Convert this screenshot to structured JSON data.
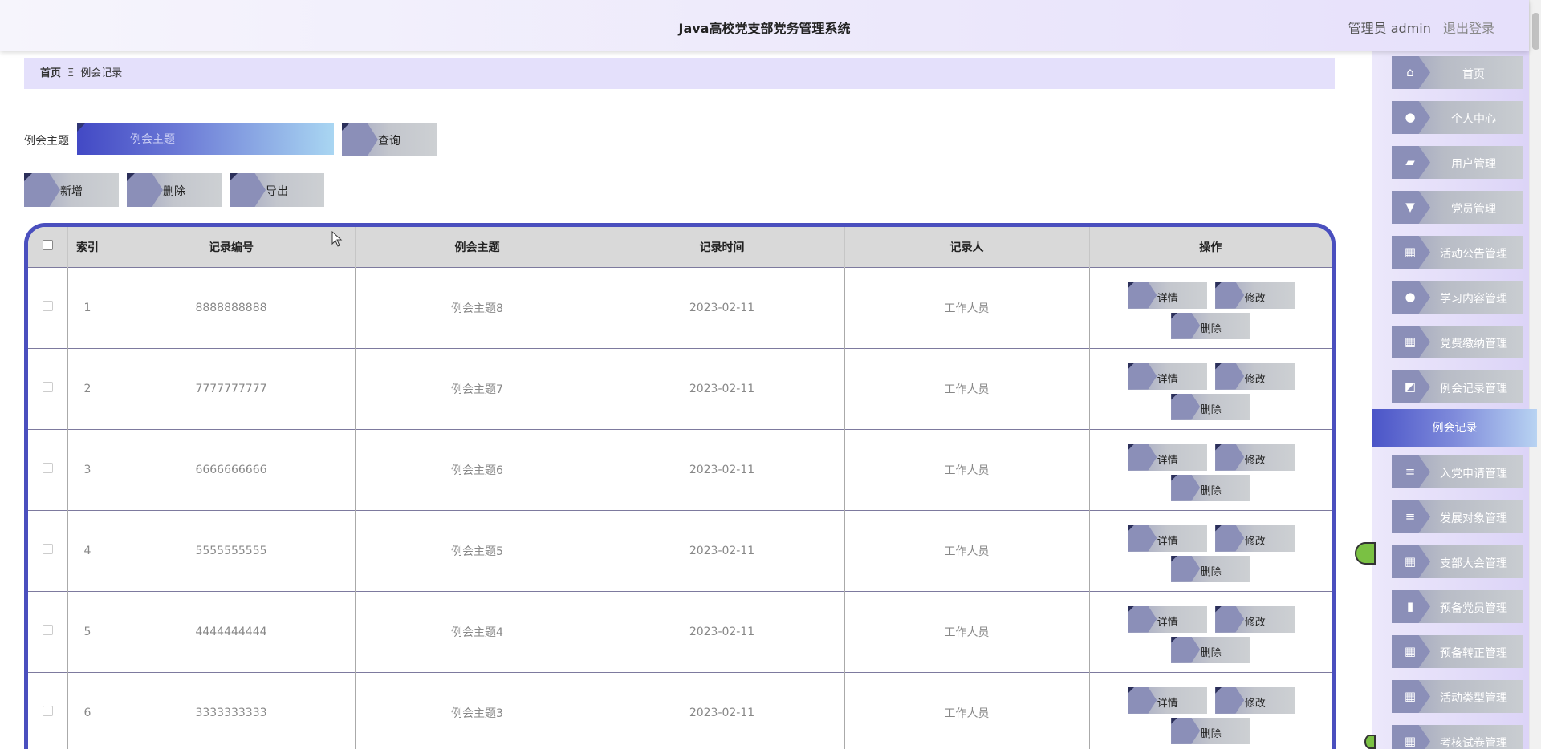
{
  "header": {
    "title": "Java高校党支部党务管理系统",
    "role": "管理员 admin",
    "logout": "退出登录"
  },
  "breadcrumb": {
    "home": "首页",
    "separator": "Ξ",
    "current": "例会记录"
  },
  "search": {
    "label": "例会主题",
    "placeholder": "例会主题",
    "query_button": "查询"
  },
  "actions": {
    "add": "新增",
    "delete": "删除",
    "export": "导出"
  },
  "table": {
    "columns": [
      "索引",
      "记录编号",
      "例会主题",
      "记录时间",
      "记录人",
      "操作"
    ],
    "rows": [
      {
        "index": "1",
        "code": "8888888888",
        "topic": "例会主题8",
        "time": "2023-02-11",
        "recorder": "工作人员"
      },
      {
        "index": "2",
        "code": "7777777777",
        "topic": "例会主题7",
        "time": "2023-02-11",
        "recorder": "工作人员"
      },
      {
        "index": "3",
        "code": "6666666666",
        "topic": "例会主题6",
        "time": "2023-02-11",
        "recorder": "工作人员"
      },
      {
        "index": "4",
        "code": "5555555555",
        "topic": "例会主题5",
        "time": "2023-02-11",
        "recorder": "工作人员"
      },
      {
        "index": "5",
        "code": "4444444444",
        "topic": "例会主题4",
        "time": "2023-02-11",
        "recorder": "工作人员"
      },
      {
        "index": "6",
        "code": "3333333333",
        "topic": "例会主题3",
        "time": "2023-02-11",
        "recorder": "工作人员"
      }
    ],
    "row_buttons": {
      "detail": "详情",
      "edit": "修改",
      "delete": "删除"
    }
  },
  "menu": {
    "items": [
      {
        "label": "首页",
        "icon": "home-icon"
      },
      {
        "label": "个人中心",
        "icon": "user-icon"
      },
      {
        "label": "用户管理",
        "icon": "briefcase-icon"
      },
      {
        "label": "党员管理",
        "icon": "monitor-icon"
      },
      {
        "label": "活动公告管理",
        "icon": "grid-icon"
      },
      {
        "label": "学习内容管理",
        "icon": "bulb-icon"
      },
      {
        "label": "党费缴纳管理",
        "icon": "grid-icon"
      },
      {
        "label": "例会记录管理",
        "icon": "chart-icon"
      }
    ],
    "active": "例会记录",
    "items_after": [
      {
        "label": "入党申请管理",
        "icon": "list-icon"
      },
      {
        "label": "发展对象管理",
        "icon": "list-icon"
      },
      {
        "label": "支部大会管理",
        "icon": "grid-icon"
      },
      {
        "label": "预备党员管理",
        "icon": "clipboard-icon"
      },
      {
        "label": "预备转正管理",
        "icon": "table-icon"
      },
      {
        "label": "活动类型管理",
        "icon": "grid-icon"
      },
      {
        "label": "考核试卷管理",
        "icon": "grid-icon"
      }
    ]
  }
}
